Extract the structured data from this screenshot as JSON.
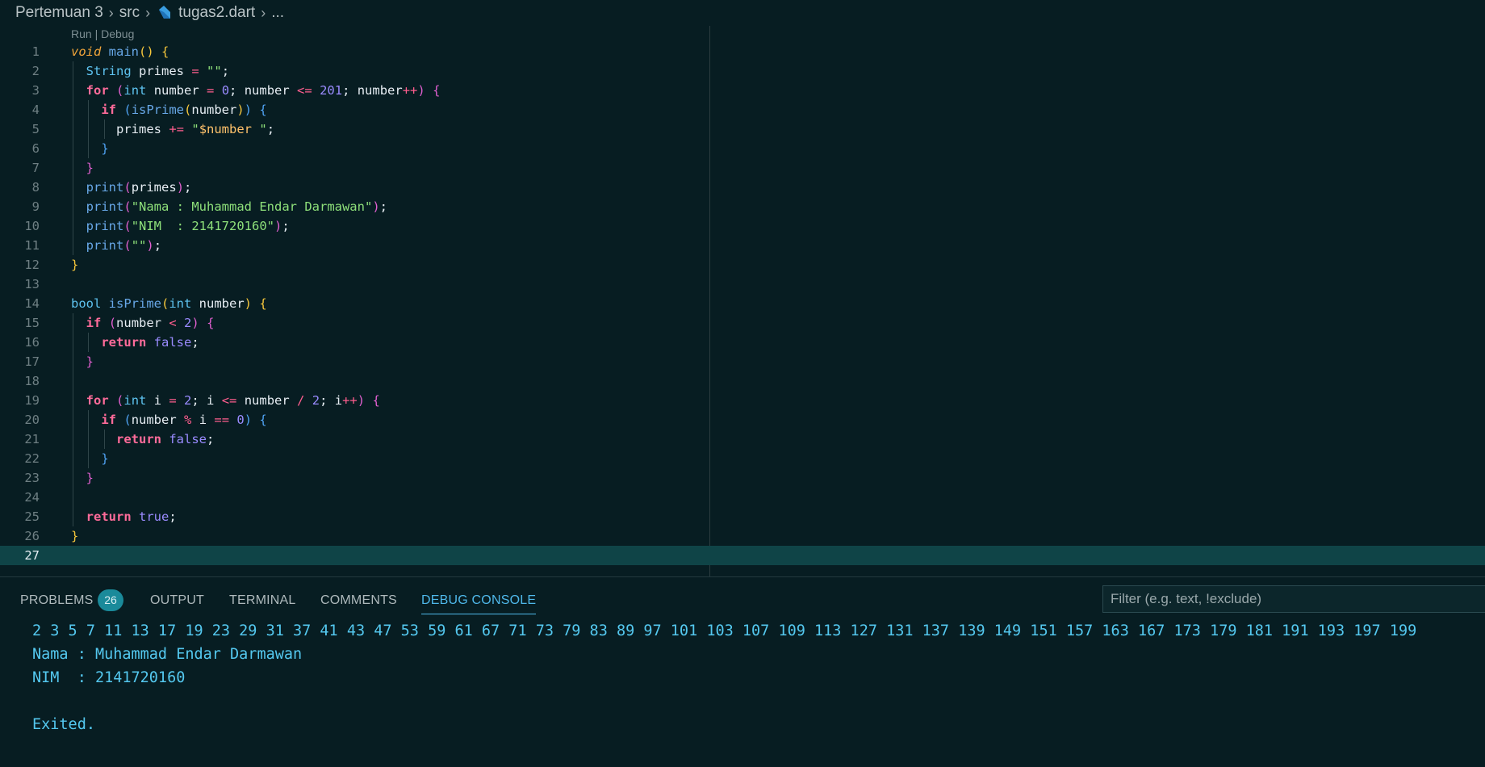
{
  "breadcrumb": {
    "folder": "Pertemuan 3",
    "subfolder": "src",
    "file": "tugas2.dart",
    "more": "..."
  },
  "codelens": {
    "run": "Run",
    "separator": " | ",
    "debug": "Debug"
  },
  "editor": {
    "current_line": 27,
    "lines": [
      {
        "n": "1",
        "tokens": [
          [
            "kw-i",
            "void"
          ],
          [
            "id",
            " "
          ],
          [
            "fn",
            "main"
          ],
          [
            "p1",
            "()"
          ],
          [
            "id",
            " "
          ],
          [
            "p1",
            "{"
          ]
        ]
      },
      {
        "n": "2",
        "g": [
          0
        ],
        "tokens": [
          [
            "id",
            "  "
          ],
          [
            "ty",
            "String"
          ],
          [
            "id",
            " primes "
          ],
          [
            "op",
            "="
          ],
          [
            "id",
            " "
          ],
          [
            "str",
            "\"\""
          ],
          [
            "id",
            ";"
          ]
        ]
      },
      {
        "n": "3",
        "g": [
          0
        ],
        "tokens": [
          [
            "id",
            "  "
          ],
          [
            "kw",
            "for"
          ],
          [
            "id",
            " "
          ],
          [
            "p2",
            "("
          ],
          [
            "ty",
            "int"
          ],
          [
            "id",
            " number "
          ],
          [
            "op",
            "="
          ],
          [
            "id",
            " "
          ],
          [
            "num",
            "0"
          ],
          [
            "id",
            "; number "
          ],
          [
            "op",
            "<="
          ],
          [
            "id",
            " "
          ],
          [
            "num",
            "201"
          ],
          [
            "id",
            "; number"
          ],
          [
            "op",
            "++"
          ],
          [
            "p2",
            ")"
          ],
          [
            "id",
            " "
          ],
          [
            "p2",
            "{"
          ]
        ]
      },
      {
        "n": "4",
        "g": [
          0,
          1
        ],
        "tokens": [
          [
            "id",
            "    "
          ],
          [
            "kw",
            "if"
          ],
          [
            "id",
            " "
          ],
          [
            "p3",
            "("
          ],
          [
            "fn",
            "isPrime"
          ],
          [
            "p1",
            "("
          ],
          [
            "id",
            "number"
          ],
          [
            "p1",
            ")"
          ],
          [
            "p3",
            ")"
          ],
          [
            "id",
            " "
          ],
          [
            "p3",
            "{"
          ]
        ]
      },
      {
        "n": "5",
        "g": [
          0,
          1,
          2
        ],
        "tokens": [
          [
            "id",
            "      primes "
          ],
          [
            "op",
            "+="
          ],
          [
            "id",
            " "
          ],
          [
            "str",
            "\""
          ],
          [
            "interp",
            "$number"
          ],
          [
            "str",
            " \""
          ],
          [
            "id",
            ";"
          ]
        ]
      },
      {
        "n": "6",
        "g": [
          0,
          1
        ],
        "tokens": [
          [
            "id",
            "    "
          ],
          [
            "p3",
            "}"
          ]
        ]
      },
      {
        "n": "7",
        "g": [
          0
        ],
        "tokens": [
          [
            "id",
            "  "
          ],
          [
            "p2",
            "}"
          ]
        ]
      },
      {
        "n": "8",
        "g": [
          0
        ],
        "tokens": [
          [
            "id",
            "  "
          ],
          [
            "fn",
            "print"
          ],
          [
            "p2",
            "("
          ],
          [
            "id",
            "primes"
          ],
          [
            "p2",
            ")"
          ],
          [
            "id",
            ";"
          ]
        ]
      },
      {
        "n": "9",
        "g": [
          0
        ],
        "tokens": [
          [
            "id",
            "  "
          ],
          [
            "fn",
            "print"
          ],
          [
            "p2",
            "("
          ],
          [
            "str",
            "\"Nama : Muhammad Endar Darmawan\""
          ],
          [
            "p2",
            ")"
          ],
          [
            "id",
            ";"
          ]
        ]
      },
      {
        "n": "10",
        "g": [
          0
        ],
        "tokens": [
          [
            "id",
            "  "
          ],
          [
            "fn",
            "print"
          ],
          [
            "p2",
            "("
          ],
          [
            "str",
            "\"NIM  : 2141720160\""
          ],
          [
            "p2",
            ")"
          ],
          [
            "id",
            ";"
          ]
        ]
      },
      {
        "n": "11",
        "g": [
          0
        ],
        "tokens": [
          [
            "id",
            "  "
          ],
          [
            "fn",
            "print"
          ],
          [
            "p2",
            "("
          ],
          [
            "str",
            "\"\""
          ],
          [
            "p2",
            ")"
          ],
          [
            "id",
            ";"
          ]
        ]
      },
      {
        "n": "12",
        "tokens": [
          [
            "p1",
            "}"
          ]
        ]
      },
      {
        "n": "13",
        "tokens": []
      },
      {
        "n": "14",
        "tokens": [
          [
            "ty",
            "bool"
          ],
          [
            "id",
            " "
          ],
          [
            "fn",
            "isPrime"
          ],
          [
            "p1",
            "("
          ],
          [
            "ty",
            "int"
          ],
          [
            "id",
            " number"
          ],
          [
            "p1",
            ")"
          ],
          [
            "id",
            " "
          ],
          [
            "p1",
            "{"
          ]
        ]
      },
      {
        "n": "15",
        "g": [
          0
        ],
        "tokens": [
          [
            "id",
            "  "
          ],
          [
            "kw",
            "if"
          ],
          [
            "id",
            " "
          ],
          [
            "p2",
            "("
          ],
          [
            "id",
            "number "
          ],
          [
            "op",
            "<"
          ],
          [
            "id",
            " "
          ],
          [
            "num",
            "2"
          ],
          [
            "p2",
            ")"
          ],
          [
            "id",
            " "
          ],
          [
            "p2",
            "{"
          ]
        ]
      },
      {
        "n": "16",
        "g": [
          0,
          1
        ],
        "tokens": [
          [
            "id",
            "    "
          ],
          [
            "kw",
            "return"
          ],
          [
            "id",
            " "
          ],
          [
            "bool",
            "false"
          ],
          [
            "id",
            ";"
          ]
        ]
      },
      {
        "n": "17",
        "g": [
          0
        ],
        "tokens": [
          [
            "id",
            "  "
          ],
          [
            "p2",
            "}"
          ]
        ]
      },
      {
        "n": "18",
        "g": [
          0
        ],
        "tokens": []
      },
      {
        "n": "19",
        "g": [
          0
        ],
        "tokens": [
          [
            "id",
            "  "
          ],
          [
            "kw",
            "for"
          ],
          [
            "id",
            " "
          ],
          [
            "p2",
            "("
          ],
          [
            "ty",
            "int"
          ],
          [
            "id",
            " i "
          ],
          [
            "op",
            "="
          ],
          [
            "id",
            " "
          ],
          [
            "num",
            "2"
          ],
          [
            "id",
            "; i "
          ],
          [
            "op",
            "<="
          ],
          [
            "id",
            " number "
          ],
          [
            "op",
            "/"
          ],
          [
            "id",
            " "
          ],
          [
            "num",
            "2"
          ],
          [
            "id",
            "; i"
          ],
          [
            "op",
            "++"
          ],
          [
            "p2",
            ")"
          ],
          [
            "id",
            " "
          ],
          [
            "p2",
            "{"
          ]
        ]
      },
      {
        "n": "20",
        "g": [
          0,
          1
        ],
        "tokens": [
          [
            "id",
            "    "
          ],
          [
            "kw",
            "if"
          ],
          [
            "id",
            " "
          ],
          [
            "p3",
            "("
          ],
          [
            "id",
            "number "
          ],
          [
            "op",
            "%"
          ],
          [
            "id",
            " i "
          ],
          [
            "op",
            "=="
          ],
          [
            "id",
            " "
          ],
          [
            "num",
            "0"
          ],
          [
            "p3",
            ")"
          ],
          [
            "id",
            " "
          ],
          [
            "p3",
            "{"
          ]
        ]
      },
      {
        "n": "21",
        "g": [
          0,
          1,
          2
        ],
        "tokens": [
          [
            "id",
            "      "
          ],
          [
            "kw",
            "return"
          ],
          [
            "id",
            " "
          ],
          [
            "bool",
            "false"
          ],
          [
            "id",
            ";"
          ]
        ]
      },
      {
        "n": "22",
        "g": [
          0,
          1
        ],
        "tokens": [
          [
            "id",
            "    "
          ],
          [
            "p3",
            "}"
          ]
        ]
      },
      {
        "n": "23",
        "g": [
          0
        ],
        "tokens": [
          [
            "id",
            "  "
          ],
          [
            "p2",
            "}"
          ]
        ]
      },
      {
        "n": "24",
        "g": [
          0
        ],
        "tokens": []
      },
      {
        "n": "25",
        "g": [
          0
        ],
        "tokens": [
          [
            "id",
            "  "
          ],
          [
            "kw",
            "return"
          ],
          [
            "id",
            " "
          ],
          [
            "bool",
            "true"
          ],
          [
            "id",
            ";"
          ]
        ]
      },
      {
        "n": "26",
        "tokens": [
          [
            "p1",
            "}"
          ]
        ]
      },
      {
        "n": "27",
        "tokens": []
      }
    ]
  },
  "panel": {
    "tabs": {
      "problems": "PROBLEMS",
      "problems_count": "26",
      "output": "OUTPUT",
      "terminal": "TERMINAL",
      "comments": "COMMENTS",
      "debug_console": "DEBUG CONSOLE"
    },
    "active_tab": "debug_console",
    "filter_placeholder": "Filter (e.g. text, !exclude)",
    "console_lines": [
      "2 3 5 7 11 13 17 19 23 29 31 37 41 43 47 53 59 61 67 71 73 79 83 89 97 101 103 107 109 113 127 131 137 139 149 151 157 163 167 173 179 181 191 193 197 199",
      "Nama : Muhammad Endar Darmawan",
      "NIM  : 2141720160",
      "",
      "Exited."
    ]
  },
  "colors": {
    "background": "#071d22",
    "current_line": "#0f4447",
    "accent": "#4fb8ea",
    "badge": "#1a8a9a",
    "console_text": "#54c8ef"
  }
}
